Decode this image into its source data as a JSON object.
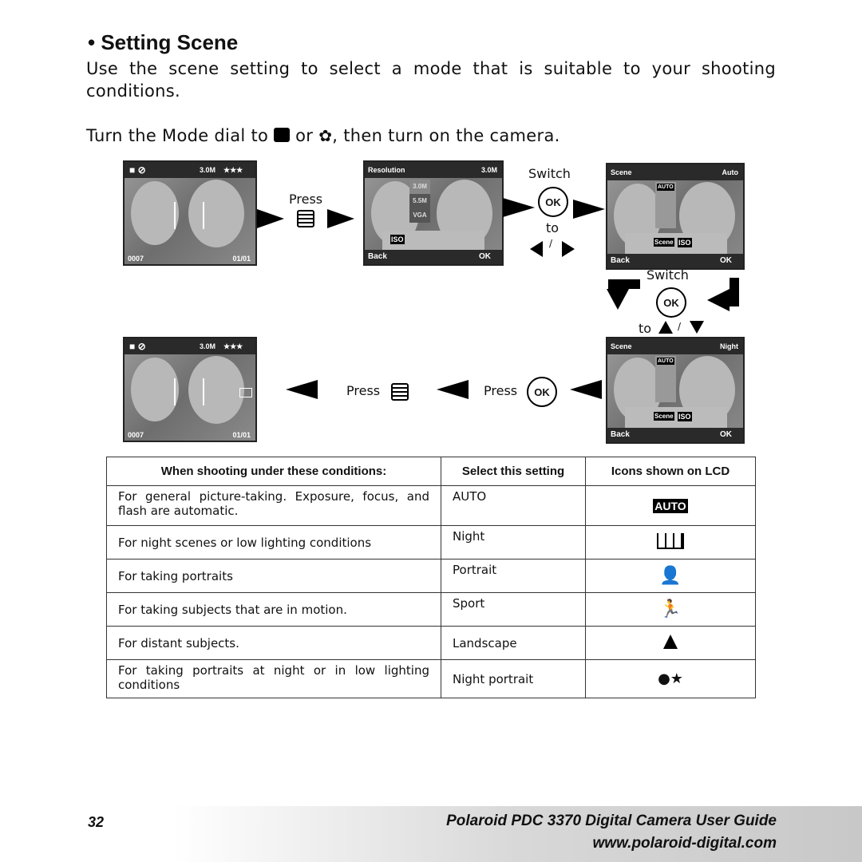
{
  "title": "• Setting Scene",
  "intro": "Use the scene setting to select a mode that is suitable to your shooting conditions.",
  "instruction": {
    "before": "Turn the Mode dial to",
    "or": "or",
    "after": ", then turn on the camera."
  },
  "diagram": {
    "press": "Press",
    "switch": "Switch",
    "to": "to",
    "slash": "/",
    "ok": "OK",
    "screen_preview": {
      "res": "3.0M",
      "quality": "★★★",
      "count": "0007",
      "date": "01/01"
    },
    "screen_resolution": {
      "title": "Resolution",
      "value": "3.0M",
      "options": [
        "3.0M",
        "5.5M",
        "VGA"
      ],
      "iso": "ISO",
      "back": "Back",
      "ok": "OK"
    },
    "screen_scene_auto": {
      "title": "Scene",
      "value": "Auto",
      "auto": "AUTO",
      "scene": "Scene",
      "iso": "ISO",
      "back": "Back",
      "ok": "OK"
    },
    "screen_scene_night": {
      "title": "Scene",
      "value": "Night",
      "auto": "AUTO",
      "scene": "Scene",
      "iso": "ISO",
      "back": "Back",
      "ok": "OK"
    }
  },
  "table": {
    "headers": [
      "When shooting under these conditions:",
      "Select this setting",
      "Icons shown on LCD"
    ],
    "rows": [
      {
        "condition": "For general picture-taking. Exposure, focus, and flash are automatic.",
        "setting": "AUTO",
        "icon": "auto-icon",
        "icon_text": "AUTO"
      },
      {
        "condition": "For night scenes or low lighting conditions",
        "setting": "Night",
        "icon": "night-scene-icon"
      },
      {
        "condition": "For taking portraits",
        "setting": "Portrait",
        "icon": "portrait-icon"
      },
      {
        "condition": "For taking subjects that are in motion.",
        "setting": "Sport",
        "icon": "sport-icon"
      },
      {
        "condition": "For distant subjects.",
        "setting": "Landscape",
        "icon": "landscape-icon"
      },
      {
        "condition": "For taking portraits at night or in low lighting conditions",
        "setting": "Night portrait",
        "icon": "night-portrait-icon"
      }
    ]
  },
  "footer": {
    "page": "32",
    "guide": "Polaroid PDC 3370 Digital Camera User Guide",
    "url": "www.polaroid-digital.com"
  }
}
